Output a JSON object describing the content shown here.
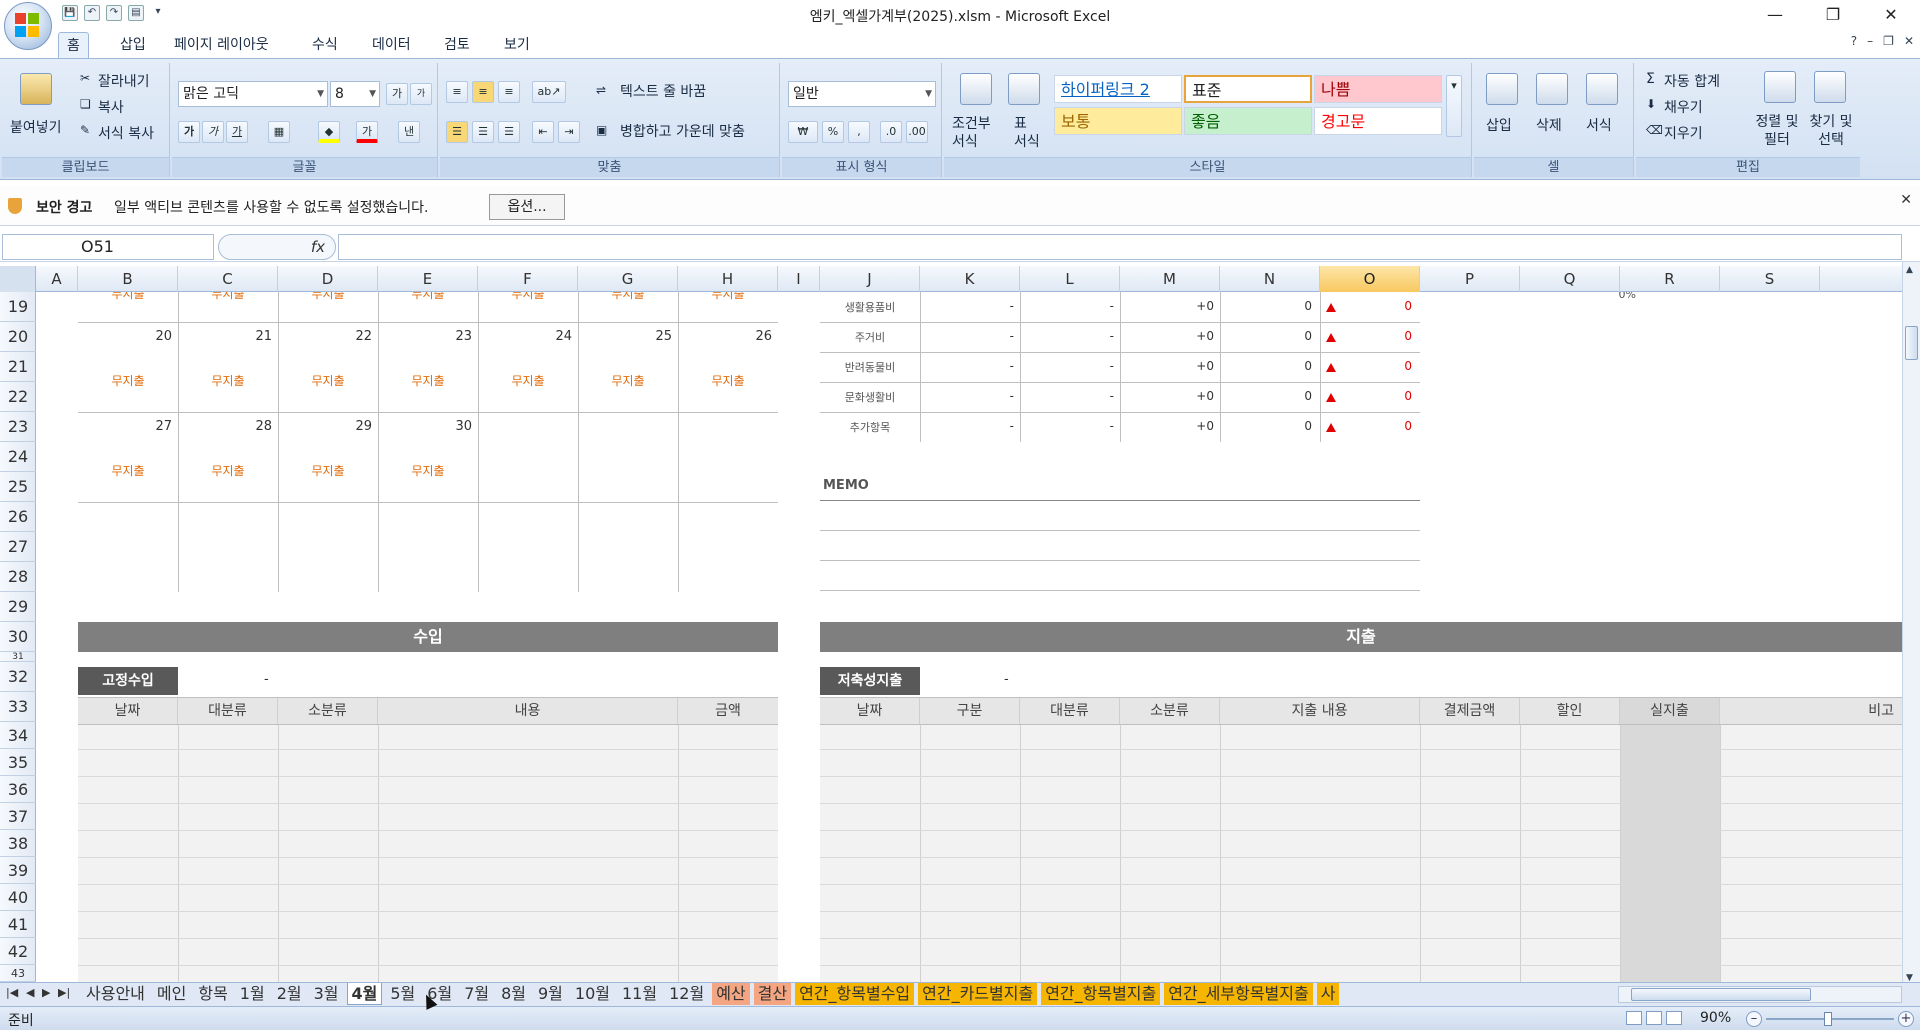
{
  "window": {
    "title": "엠키_엑셀가계부(2025).xlsm - Microsoft Excel",
    "minimize": "—",
    "restore": "❐",
    "close": "✕"
  },
  "qat": {
    "save": "💾",
    "undo": "↶",
    "redo": "↷",
    "print": "▤",
    "more": "▾"
  },
  "ribbon_tabs": [
    "홈",
    "삽입",
    "페이지 레이아웃",
    "수식",
    "데이터",
    "검토",
    "보기"
  ],
  "ribbon_right": {
    "help": "?",
    "min": "–",
    "restore": "❐",
    "close": "✕"
  },
  "clipboard": {
    "paste": "붙여넣기",
    "cut": "잘라내기",
    "copy": "복사",
    "format_painter": "서식 복사",
    "label": "클립보드"
  },
  "font": {
    "name": "맑은 고딕",
    "size": "8",
    "grow": "가",
    "shrink": "가",
    "bold": "가",
    "italic": "가",
    "underline": "가",
    "label": "글꼴",
    "fill_color": "#ffff00",
    "font_color": "#ff0000"
  },
  "alignment": {
    "wrap": "텍스트 줄 바꿈",
    "merge": "병합하고 가운데 맞춤",
    "label": "맞춤"
  },
  "number": {
    "format": "일반",
    "currency": "₩",
    "percent": "%",
    "comma": ",",
    "label": "표시 형식"
  },
  "styles": {
    "conditional": "조건부 서식",
    "table": "표 서식",
    "label": "스타일",
    "cells": [
      {
        "text": "하이퍼링크 2",
        "bg": "#ffffff",
        "color": "#0563c1"
      },
      {
        "text": "표준",
        "bg": "#ffffff",
        "color": "#222222"
      },
      {
        "text": "나쁨",
        "bg": "#ffc7ce",
        "color": "#9c0006"
      },
      {
        "text": "보통",
        "bg": "#ffeb9c",
        "color": "#9c6500"
      },
      {
        "text": "좋음",
        "bg": "#c6efce",
        "color": "#006100"
      },
      {
        "text": "경고문",
        "bg": "#ffffff",
        "color": "#ff0000"
      }
    ]
  },
  "cells_group": {
    "insert": "삽입",
    "delete": "삭제",
    "format": "서식",
    "label": "셀"
  },
  "editing": {
    "autosum": "자동 합계",
    "fill": "채우기",
    "clear": "지우기",
    "sort": "정렬 및 필터",
    "find": "찾기 및 선택",
    "label": "편집"
  },
  "security": {
    "title": "보안 경고",
    "message": "일부 액티브 콘텐츠를 사용할 수 없도록 설정했습니다.",
    "options": "옵션..."
  },
  "formula_bar": {
    "name_box": "O51",
    "fx": "fx",
    "value": ""
  },
  "columns": [
    "A",
    "B",
    "C",
    "D",
    "E",
    "F",
    "G",
    "H",
    "I",
    "J",
    "K",
    "L",
    "M",
    "N",
    "O",
    "P",
    "Q",
    "R",
    "S"
  ],
  "selected_column": "O",
  "rows": [
    "19",
    "20",
    "21",
    "22",
    "23",
    "24",
    "25",
    "26",
    "27",
    "28",
    "29",
    "30",
    "31",
    "32",
    "33",
    "34",
    "35",
    "36",
    "37",
    "38",
    "39",
    "40",
    "41",
    "42",
    "43"
  ],
  "calendar": {
    "row1_top_labels": [
      "무지출",
      "무지출",
      "무지출",
      "무지출",
      "무지출",
      "무지출",
      "무지출"
    ],
    "week1_dates": [
      "20",
      "21",
      "22",
      "23",
      "24",
      "25",
      "26"
    ],
    "week1_labels": [
      "무지출",
      "무지출",
      "무지출",
      "무지출",
      "무지출",
      "무지출",
      "무지출"
    ],
    "week2_dates": [
      "27",
      "28",
      "29",
      "30"
    ],
    "week2_labels": [
      "무지출",
      "무지출",
      "무지출",
      "무지출"
    ]
  },
  "summary": {
    "top_right": "0%",
    "rows": [
      {
        "category": "생활용품비",
        "k": "-",
        "l": "-",
        "m": "+0",
        "n": "0",
        "o": "0"
      },
      {
        "category": "주거비",
        "k": "-",
        "l": "-",
        "m": "+0",
        "n": "0",
        "o": "0"
      },
      {
        "category": "반려동물비",
        "k": "-",
        "l": "-",
        "m": "+0",
        "n": "0",
        "o": "0"
      },
      {
        "category": "문화생활비",
        "k": "-",
        "l": "-",
        "m": "+0",
        "n": "0",
        "o": "0"
      },
      {
        "category": "추가항목",
        "k": "-",
        "l": "-",
        "m": "+0",
        "n": "0",
        "o": "0"
      }
    ]
  },
  "memo": "MEMO",
  "income": {
    "title": "수입",
    "fixed_label": "고정수입",
    "fixed_value": "-",
    "headers": [
      "날짜",
      "대분류",
      "소분류",
      "내용",
      "금액"
    ]
  },
  "expense": {
    "title": "지출",
    "saving_label": "저축성지출",
    "saving_value": "-",
    "headers": [
      "날짜",
      "구분",
      "대분류",
      "소분류",
      "지출 내용",
      "결제금액",
      "할인",
      "실지출",
      "비고"
    ]
  },
  "sheet_tabs": [
    {
      "name": "사용안내",
      "style": "normal"
    },
    {
      "name": "메인",
      "style": "normal"
    },
    {
      "name": "항목",
      "style": "normal"
    },
    {
      "name": "1월",
      "style": "normal"
    },
    {
      "name": "2월",
      "style": "normal"
    },
    {
      "name": "3월",
      "style": "normal"
    },
    {
      "name": "4월",
      "style": "active"
    },
    {
      "name": "5월",
      "style": "normal"
    },
    {
      "name": "6월",
      "style": "normal"
    },
    {
      "name": "7월",
      "style": "normal"
    },
    {
      "name": "8월",
      "style": "normal"
    },
    {
      "name": "9월",
      "style": "normal"
    },
    {
      "name": "10월",
      "style": "normal"
    },
    {
      "name": "11월",
      "style": "normal"
    },
    {
      "name": "12월",
      "style": "normal"
    },
    {
      "name": "예산",
      "style": "salmon"
    },
    {
      "name": "결산",
      "style": "salmon"
    },
    {
      "name": "연간_항목별수입",
      "style": "orange"
    },
    {
      "name": "연간_카드별지출",
      "style": "orange"
    },
    {
      "name": "연간_항목별지출",
      "style": "orange"
    },
    {
      "name": "연간_세부항목별지출",
      "style": "orange"
    },
    {
      "name": "사",
      "style": "orange"
    }
  ],
  "status": {
    "ready": "준비",
    "zoom": "90%"
  }
}
